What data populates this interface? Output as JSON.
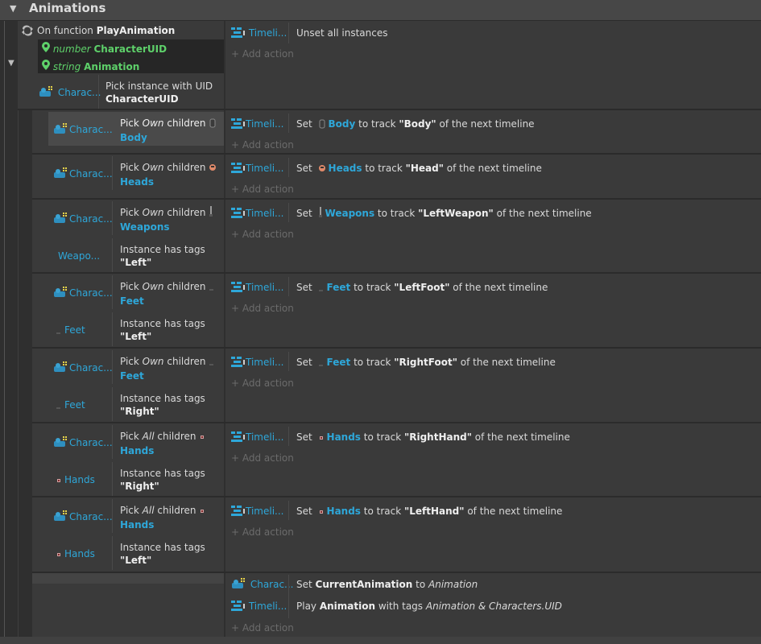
{
  "group": {
    "title": "Animations",
    "toggle_icon": "collapse-triangle-icon"
  },
  "function_event": {
    "prefix": "On function ",
    "name": "PlayAnimation",
    "params": [
      {
        "type": "number",
        "name": "CharacterUID"
      },
      {
        "type": "string",
        "name": "Animation"
      }
    ],
    "condition": {
      "object": "Charac...",
      "line1": "Pick instance with UID",
      "line2": "CharacterUID"
    },
    "action": {
      "object": "Timeli...",
      "text": "Unset all instances"
    },
    "add_action": "Add action"
  },
  "sub_events": [
    {
      "conditions": [
        {
          "object": "Charac...",
          "pre": "Pick ",
          "mode": "Own",
          "post": " children",
          "target": "Body"
        }
      ],
      "action": {
        "object": "Timeli...",
        "set": "Set ",
        "family": "Body",
        "mid": " to track ",
        "track": "\"Body\"",
        "tail": " of the next timeline"
      },
      "add_action": "Add action"
    },
    {
      "conditions": [
        {
          "object": "Charac...",
          "pre": "Pick ",
          "mode": "Own",
          "post": " children",
          "target": "Heads"
        }
      ],
      "action": {
        "object": "Timeli...",
        "set": "Set ",
        "family": "Heads",
        "mid": " to track ",
        "track": "\"Head\"",
        "tail": " of the next timeline"
      },
      "add_action": "Add action"
    },
    {
      "conditions": [
        {
          "object": "Charac...",
          "pre": "Pick ",
          "mode": "Own",
          "post": " children",
          "target": "Weapons"
        },
        {
          "object": "Weapo...",
          "line1": "Instance has tags",
          "line2": "\"Left\""
        }
      ],
      "action": {
        "object": "Timeli...",
        "set": "Set ",
        "family": "Weapons",
        "mid": " to track ",
        "track": "\"LeftWeapon\"",
        "tail": " of the next timeline"
      },
      "add_action": "Add action"
    },
    {
      "conditions": [
        {
          "object": "Charac...",
          "pre": "Pick ",
          "mode": "Own",
          "post": " children",
          "target": "Feet"
        },
        {
          "object": "Feet",
          "line1": "Instance has tags",
          "line2": "\"Left\""
        }
      ],
      "action": {
        "object": "Timeli...",
        "set": "Set ",
        "family": "Feet",
        "mid": " to track ",
        "track": "\"LeftFoot\"",
        "tail": " of the next timeline"
      },
      "add_action": "Add action"
    },
    {
      "conditions": [
        {
          "object": "Charac...",
          "pre": "Pick ",
          "mode": "Own",
          "post": " children",
          "target": "Feet"
        },
        {
          "object": "Feet",
          "line1": "Instance has tags",
          "line2": "\"Right\""
        }
      ],
      "action": {
        "object": "Timeli...",
        "set": "Set ",
        "family": "Feet",
        "mid": " to track ",
        "track": "\"RightFoot\"",
        "tail": " of the next timeline"
      },
      "add_action": "Add action"
    },
    {
      "conditions": [
        {
          "object": "Charac...",
          "pre": "Pick ",
          "mode": "All",
          "post": " children",
          "target": "Hands"
        },
        {
          "object": "Hands",
          "line1": "Instance has tags",
          "line2": "\"Right\""
        }
      ],
      "action": {
        "object": "Timeli...",
        "set": "Set ",
        "family": "Hands",
        "mid": " to track ",
        "track": "\"RightHand\"",
        "tail": " of the next timeline"
      },
      "add_action": "Add action"
    },
    {
      "conditions": [
        {
          "object": "Charac...",
          "pre": "Pick ",
          "mode": "All",
          "post": " children",
          "target": "Hands"
        },
        {
          "object": "Hands",
          "line1": "Instance has tags",
          "line2": "\"Left\""
        }
      ],
      "action": {
        "object": "Timeli...",
        "set": "Set ",
        "family": "Hands",
        "mid": " to track ",
        "track": "\"LeftHand\"",
        "tail": " of the next timeline"
      },
      "add_action": "Add action"
    }
  ],
  "final_event": {
    "actions": [
      {
        "object": "Charac...",
        "pre": "Set ",
        "var": "CurrentAnimation",
        "mid": " to ",
        "val": "Animation"
      },
      {
        "object": "Timeli...",
        "pre": "Play ",
        "var": "Animation",
        "mid": " with tags ",
        "val": "Animation & Characters.UID"
      }
    ],
    "add_action": "Add action"
  },
  "colors": {
    "accent_blue": "#2ea7d9",
    "param_green": "#5ed16a",
    "background": "#2f2f2f",
    "panel": "#3a3a3a"
  }
}
